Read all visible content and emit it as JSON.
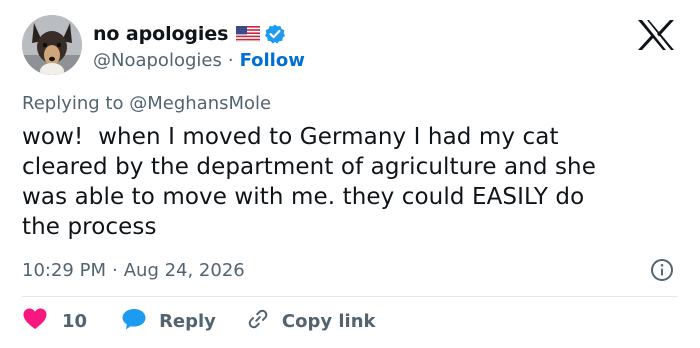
{
  "author": {
    "display_name": "no apologies",
    "handle": "@Noapologies",
    "separator": "·",
    "follow_label": "Follow",
    "flag_icon": "us-flag-icon",
    "verified_icon": "verified-badge-icon",
    "verified_color": "#1d9bf0"
  },
  "reply_context": {
    "prefix": "Replying to",
    "target": "@MeghansMole"
  },
  "tweet": {
    "text": "wow!  when I moved to Germany I had my cat\ncleared by the department of agriculture and she\nwas able to move with me. they could EASILY do\nthe process"
  },
  "meta": {
    "time": "10:29 PM",
    "separator": "·",
    "date": "Aug 24, 2026"
  },
  "actions": {
    "like_count": "10",
    "like_color": "#f91880",
    "reply_label": "Reply",
    "reply_color": "#1d9bf0",
    "copy_label": "Copy link"
  },
  "brand": {
    "logo": "x-logo-icon"
  }
}
